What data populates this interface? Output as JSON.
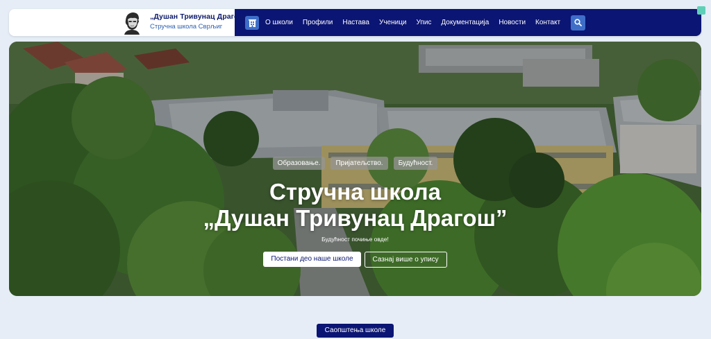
{
  "brand": {
    "title": "„Душан Тривунац Драгош”",
    "subtitle": "Стручна школа Сврљиг"
  },
  "nav": {
    "home_icon": "building-icon",
    "items": [
      {
        "label": "О школи"
      },
      {
        "label": "Профили"
      },
      {
        "label": "Настава"
      },
      {
        "label": "Ученици"
      },
      {
        "label": "Упис"
      },
      {
        "label": "Документација"
      },
      {
        "label": "Новости"
      },
      {
        "label": "Контакт"
      }
    ],
    "search_icon": "search-icon"
  },
  "hero": {
    "tags": [
      "Образовање.",
      "Пријатељство.",
      "Будућност."
    ],
    "title_line1": "Стручна школа",
    "title_line2": "„Душан Тривунац Драгош”",
    "subtitle": "Будућност почиње овде!",
    "primary_button": "Постани део наше школе",
    "secondary_button": "Сазнај више о упису"
  },
  "announcements": {
    "label": "Саопштења школе"
  },
  "colors": {
    "navy": "#0b1573",
    "accent_blue": "#3f6ec9",
    "page_bg": "#e6edf6"
  }
}
